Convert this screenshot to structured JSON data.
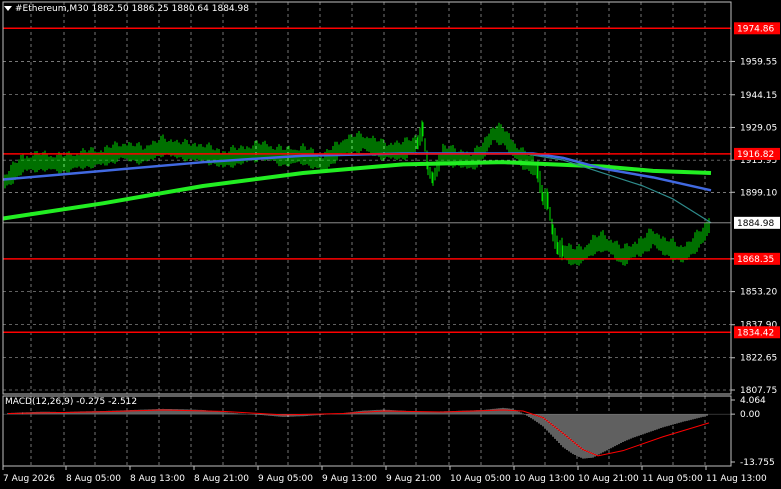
{
  "header": {
    "symbol": "#Ethereum,M30",
    "open": "1882.50",
    "high": "1886.25",
    "low": "1880.64",
    "close": "1884.98"
  },
  "macd_header": {
    "label": "MACD(12,26,9)",
    "value": "-0.275",
    "signal": "-2.512"
  },
  "price_axis": {
    "ticks": [
      "1959.55",
      "1944.15",
      "1929.05",
      "1913.95",
      "1899.10",
      "1868.35",
      "1853.20",
      "1837.90",
      "1822.65",
      "1807.75"
    ],
    "ylim": [
      1807.75,
      1981
    ]
  },
  "macd_axis": {
    "ticks": [
      "4.064",
      "0.00",
      "-13.755"
    ],
    "ylim": [
      -13.755,
      4.064
    ]
  },
  "time_axis": {
    "labels": [
      "7 Aug 2026",
      "8 Aug 05:00",
      "8 Aug 13:00",
      "8 Aug 21:00",
      "9 Aug 05:00",
      "9 Aug 13:00",
      "9 Aug 21:00",
      "10 Aug 05:00",
      "10 Aug 13:00",
      "10 Aug 21:00",
      "11 Aug 05:00",
      "11 Aug 13:00"
    ]
  },
  "levels": [
    {
      "price": 1974.86,
      "label": "1974.86"
    },
    {
      "price": 1916.82,
      "label": "1916.82"
    },
    {
      "price": 1868.35,
      "label": "1868.35"
    },
    {
      "price": 1834.42,
      "label": "1834.42"
    }
  ],
  "current_price": {
    "price": 1884.98,
    "label": "1884.98"
  },
  "colors": {
    "background": "#000000",
    "grid": "#c0c0c0",
    "candles": "#00e000",
    "level_line": "#ff0000",
    "level_label_bg": "#ff0000",
    "ma_fast": "#4169e1",
    "ma_slow": "#22ee22",
    "ma_short": "#2e8b8b",
    "macd_hist": "#c0c0c0",
    "macd_signal": "#ff0000"
  },
  "chart_data": {
    "type": "line",
    "close_path": [
      [
        0,
        1903
      ],
      [
        20,
        1912
      ],
      [
        40,
        1913
      ],
      [
        60,
        1912
      ],
      [
        80,
        1914
      ],
      [
        100,
        1915
      ],
      [
        120,
        1918
      ],
      [
        140,
        1916
      ],
      [
        160,
        1920
      ],
      [
        180,
        1918
      ],
      [
        200,
        1917
      ],
      [
        220,
        1914
      ],
      [
        240,
        1916
      ],
      [
        260,
        1918
      ],
      [
        280,
        1915
      ],
      [
        300,
        1916
      ],
      [
        320,
        1912
      ],
      [
        340,
        1920
      ],
      [
        360,
        1922
      ],
      [
        380,
        1918
      ],
      [
        400,
        1918
      ],
      [
        415,
        1922
      ],
      [
        420,
        1928
      ],
      [
        425,
        1910
      ],
      [
        430,
        1905
      ],
      [
        440,
        1917
      ],
      [
        450,
        1915
      ],
      [
        460,
        1914
      ],
      [
        470,
        1913
      ],
      [
        480,
        1918
      ],
      [
        490,
        1926
      ],
      [
        500,
        1925
      ],
      [
        510,
        1919
      ],
      [
        520,
        1914
      ],
      [
        530,
        1911
      ],
      [
        535,
        1908
      ],
      [
        540,
        1896
      ],
      [
        545,
        1895
      ],
      [
        550,
        1880
      ],
      [
        555,
        1873
      ],
      [
        560,
        1872
      ],
      [
        570,
        1869
      ],
      [
        580,
        1870
      ],
      [
        590,
        1874
      ],
      [
        600,
        1876
      ],
      [
        610,
        1873
      ],
      [
        620,
        1869
      ],
      [
        630,
        1872
      ],
      [
        640,
        1874
      ],
      [
        650,
        1878
      ],
      [
        660,
        1874
      ],
      [
        670,
        1872
      ],
      [
        680,
        1870
      ],
      [
        690,
        1874
      ],
      [
        700,
        1879
      ],
      [
        708,
        1885
      ]
    ],
    "ma_slow": [
      [
        0,
        1887
      ],
      [
        100,
        1894
      ],
      [
        200,
        1902
      ],
      [
        300,
        1908
      ],
      [
        400,
        1912
      ],
      [
        500,
        1913
      ],
      [
        550,
        1912
      ],
      [
        600,
        1911
      ],
      [
        650,
        1909
      ],
      [
        708,
        1908
      ]
    ],
    "ma_fast": [
      [
        0,
        1905
      ],
      [
        100,
        1909
      ],
      [
        200,
        1913
      ],
      [
        300,
        1916
      ],
      [
        400,
        1917
      ],
      [
        500,
        1917
      ],
      [
        530,
        1917
      ],
      [
        560,
        1915
      ],
      [
        600,
        1910
      ],
      [
        650,
        1906
      ],
      [
        708,
        1900
      ]
    ],
    "ma_short": [
      [
        520,
        1917
      ],
      [
        560,
        1914
      ],
      [
        600,
        1908
      ],
      [
        640,
        1902
      ],
      [
        670,
        1896
      ],
      [
        708,
        1885
      ]
    ],
    "macd_hist": [
      [
        5,
        0.3
      ],
      [
        20,
        0.5
      ],
      [
        40,
        0.7
      ],
      [
        60,
        0.6
      ],
      [
        80,
        0.8
      ],
      [
        100,
        0.9
      ],
      [
        120,
        1.1
      ],
      [
        140,
        1.3
      ],
      [
        160,
        1.5
      ],
      [
        180,
        1.4
      ],
      [
        200,
        1.2
      ],
      [
        220,
        0.6
      ],
      [
        240,
        0.1
      ],
      [
        260,
        -0.3
      ],
      [
        280,
        -0.8
      ],
      [
        300,
        -0.6
      ],
      [
        320,
        -0.2
      ],
      [
        340,
        0.3
      ],
      [
        360,
        1.0
      ],
      [
        380,
        1.3
      ],
      [
        400,
        1.0
      ],
      [
        420,
        0.6
      ],
      [
        440,
        0.8
      ],
      [
        460,
        1.0
      ],
      [
        480,
        1.2
      ],
      [
        500,
        1.8
      ],
      [
        510,
        1.5
      ],
      [
        520,
        0.2
      ],
      [
        530,
        -1.5
      ],
      [
        540,
        -3.5
      ],
      [
        550,
        -6.5
      ],
      [
        560,
        -9.5
      ],
      [
        570,
        -11.5
      ],
      [
        580,
        -12.8
      ],
      [
        590,
        -12.5
      ],
      [
        600,
        -11.0
      ],
      [
        610,
        -9.5
      ],
      [
        620,
        -8.0
      ],
      [
        630,
        -6.8
      ],
      [
        640,
        -5.8
      ],
      [
        650,
        -4.8
      ],
      [
        660,
        -3.8
      ],
      [
        670,
        -3.0
      ],
      [
        680,
        -2.2
      ],
      [
        690,
        -1.5
      ],
      [
        700,
        -0.8
      ],
      [
        706,
        -0.3
      ]
    ],
    "macd_signal": [
      [
        5,
        0.2
      ],
      [
        100,
        0.7
      ],
      [
        160,
        1.2
      ],
      [
        220,
        0.8
      ],
      [
        280,
        -0.2
      ],
      [
        340,
        0.2
      ],
      [
        380,
        0.9
      ],
      [
        440,
        0.6
      ],
      [
        500,
        1.2
      ],
      [
        520,
        0.9
      ],
      [
        540,
        -1.0
      ],
      [
        560,
        -5.5
      ],
      [
        580,
        -10.2
      ],
      [
        595,
        -12.0
      ],
      [
        620,
        -10.5
      ],
      [
        660,
        -6.5
      ],
      [
        706,
        -2.5
      ]
    ]
  }
}
